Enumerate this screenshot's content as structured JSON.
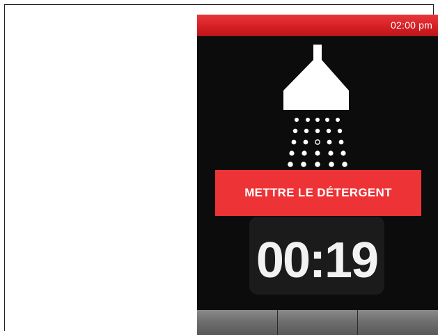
{
  "status_bar": {
    "time": "02:00 pm",
    "color": "#d61f24"
  },
  "main": {
    "icon": "shower-head-icon",
    "instruction": "METTRE LE DÉTERGENT",
    "timer": "00:19",
    "banner_color": "#ee3336"
  },
  "bottom_bar": {
    "keys": [
      "",
      "",
      ""
    ]
  }
}
